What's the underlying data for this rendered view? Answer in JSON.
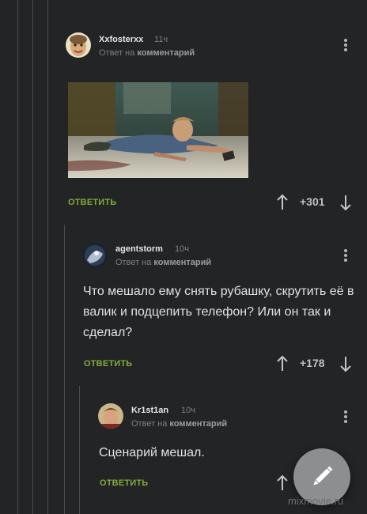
{
  "comments": [
    {
      "username": "Xxfosterxx",
      "time": "11ч",
      "reply_prefix": "Ответ на",
      "reply_target": "комментарий",
      "reply_label": "ОТВЕТИТЬ",
      "rating": "+301"
    },
    {
      "username": "agentstorm",
      "time": "10ч",
      "reply_prefix": "Ответ на",
      "reply_target": "комментарий",
      "text": "Что мешало ему снять рубашку, скрутить её в валик и подцепить телефон? Или он так и сделал?",
      "reply_label": "ОТВЕТИТЬ",
      "rating": "+178"
    },
    {
      "username": "Kr1st1an",
      "time": "10ч",
      "reply_prefix": "Ответ на",
      "reply_target": "комментарий",
      "text": "Сценарий мешал.",
      "reply_label": "ОТВЕТИТЬ"
    }
  ],
  "fab": {
    "icon": "pencil-icon"
  },
  "watermark": "mixmovie.ru",
  "colors": {
    "background": "#232425",
    "accent_green": "#7fae3c",
    "thread_line": "#4a4c4d",
    "fab": "#8c8e8f"
  }
}
